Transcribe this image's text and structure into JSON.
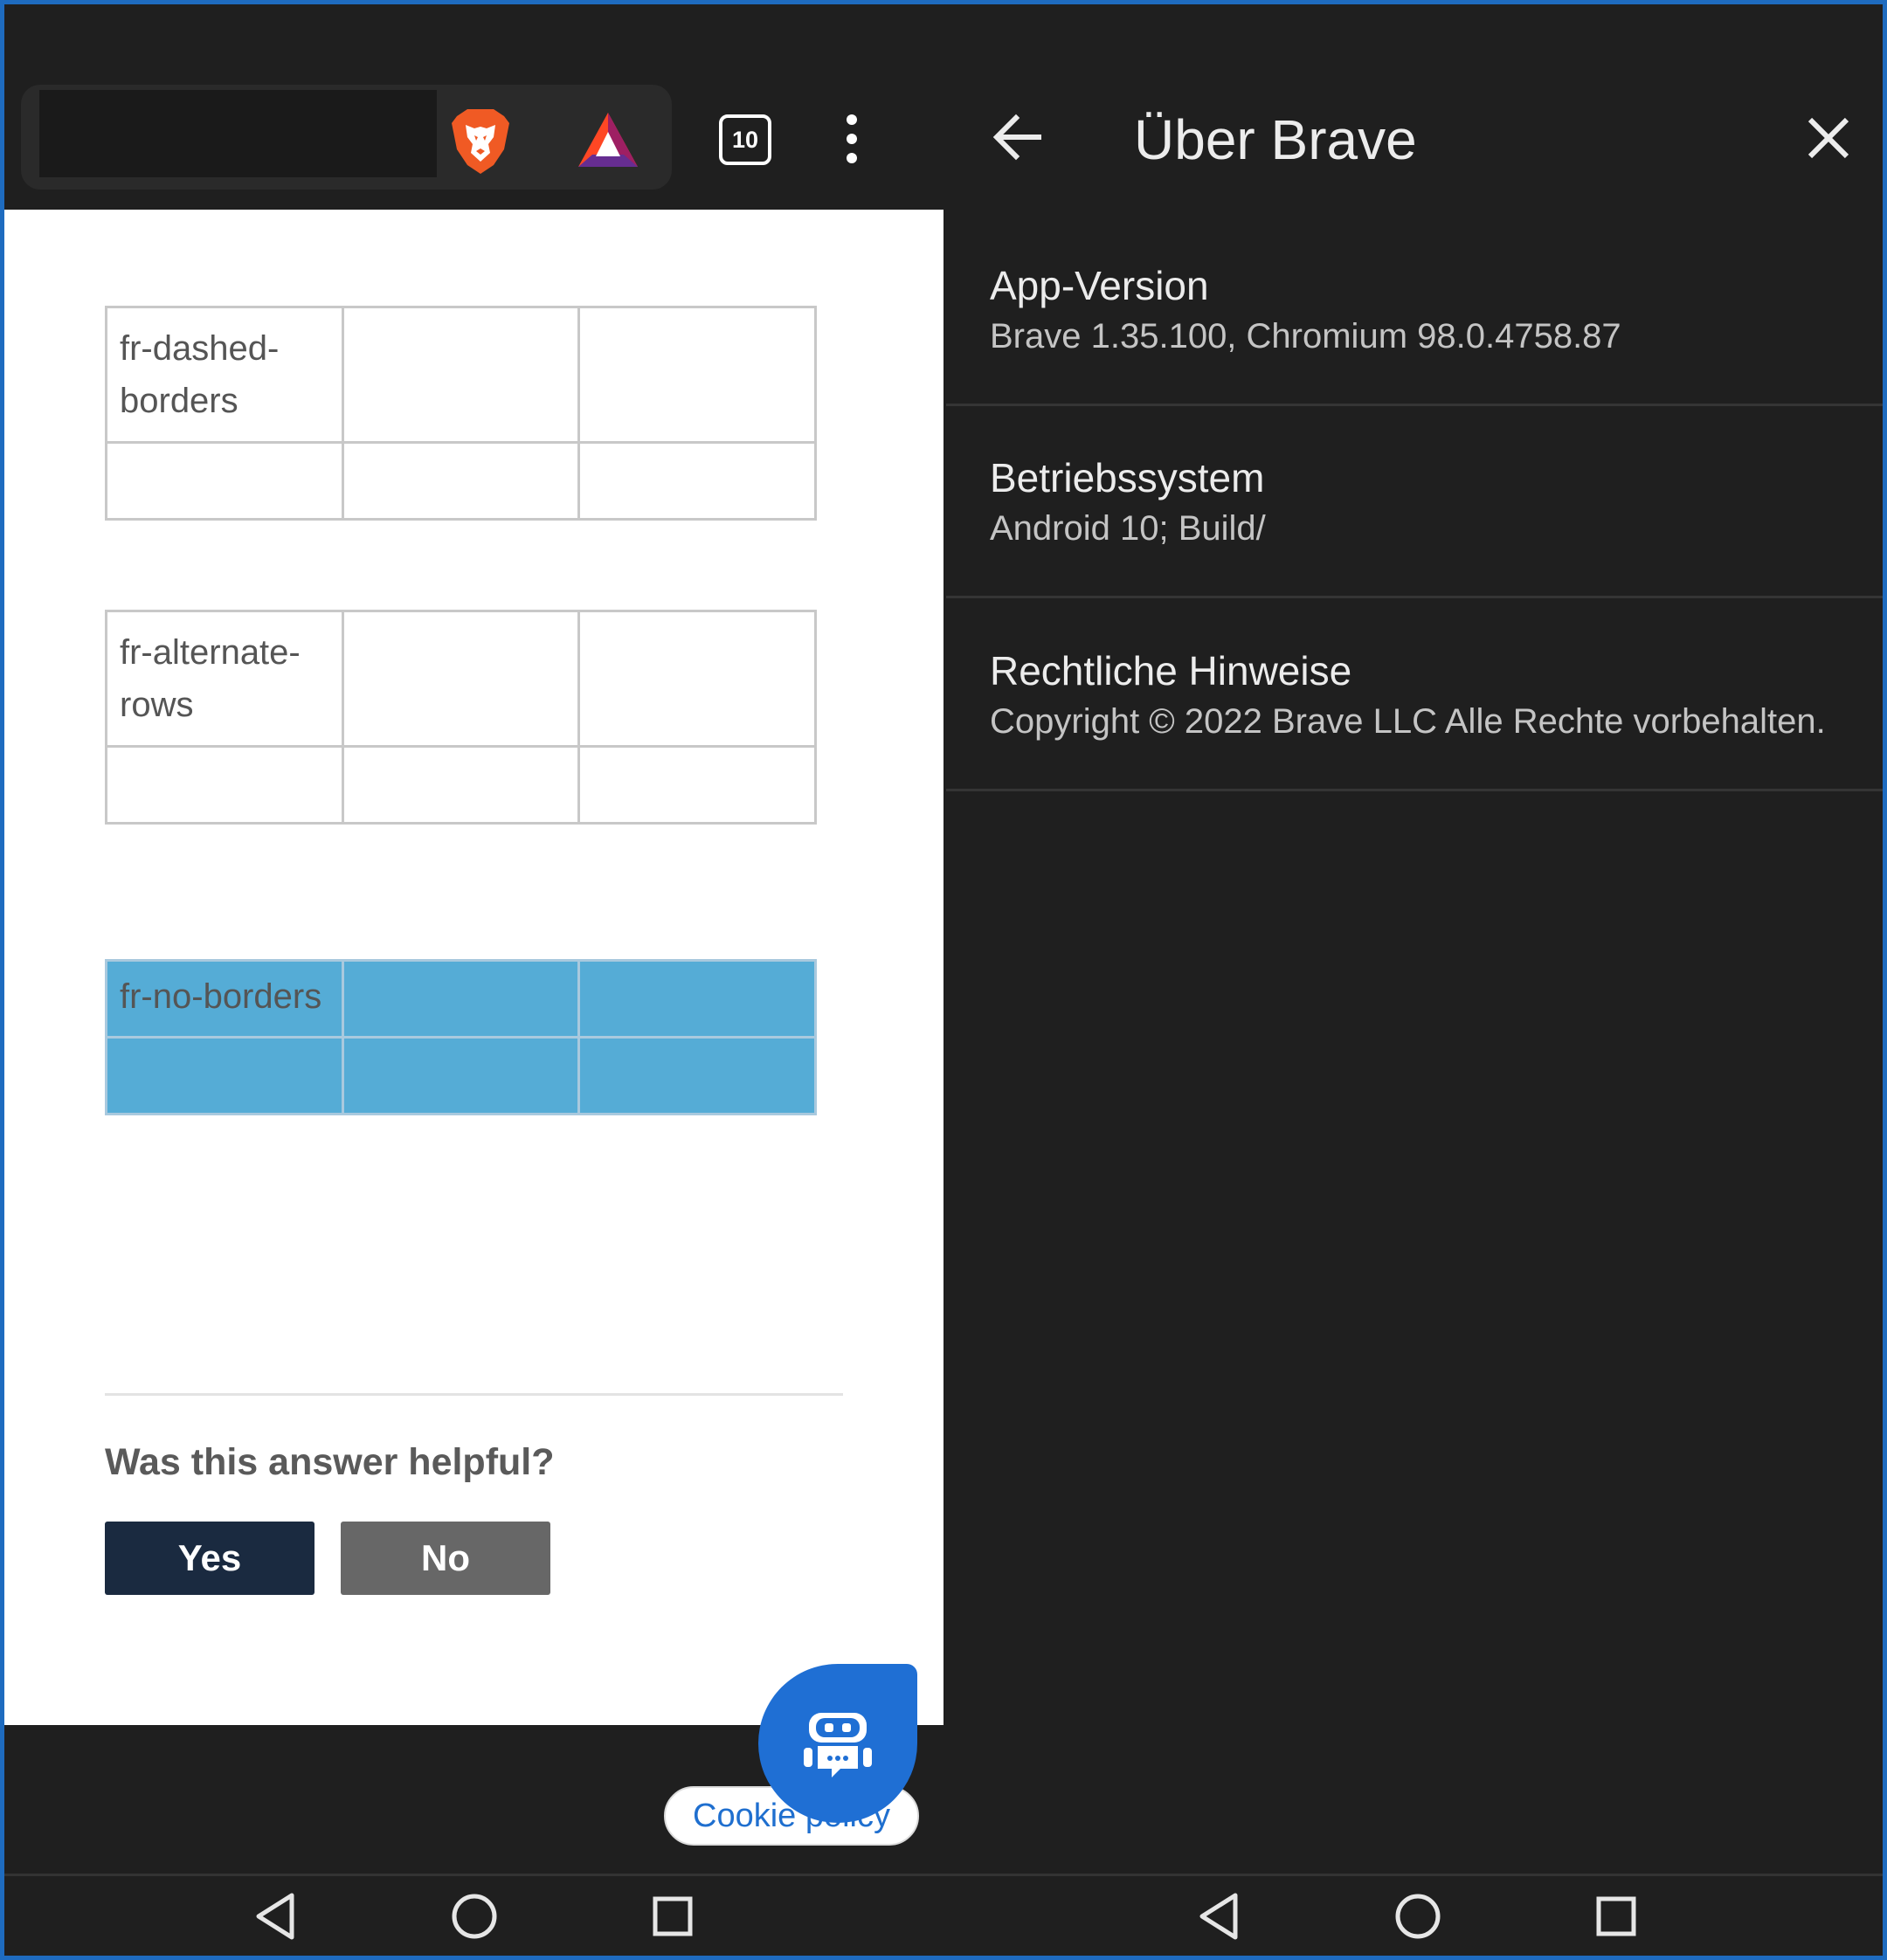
{
  "browser": {
    "tab_count": "10",
    "icons": {
      "shields": "brave-lion-icon",
      "rewards": "bat-rewards-icon",
      "menu": "more-vert-icon"
    }
  },
  "web_page": {
    "tables": [
      {
        "label": "fr-dashed-borders"
      },
      {
        "label": "fr-alternate-rows"
      },
      {
        "label": "fr-no-borders"
      }
    ],
    "feedback": {
      "question": "Was this answer helpful?",
      "yes_label": "Yes",
      "no_label": "No"
    },
    "cookie_policy_label": "Cookie policy",
    "chat_icon": "chatbot-icon"
  },
  "settings": {
    "title": "Über Brave",
    "items": [
      {
        "title": "App-Version",
        "value": "Brave 1.35.100, Chromium 98.0.4758.87"
      },
      {
        "title": "Betriebssystem",
        "value": "Android 10; Build/"
      },
      {
        "title": "Rechtliche Hinweise",
        "value": "Copyright © 2022 Brave LLC Alle Rechte vorbehalten."
      }
    ]
  },
  "colors": {
    "no_borders_fill": "#55acd6",
    "yes_button": "#1a2a40",
    "no_button": "#676767",
    "chat_bubble": "#1f6fd4",
    "panel_bg": "#1f1f1f"
  }
}
